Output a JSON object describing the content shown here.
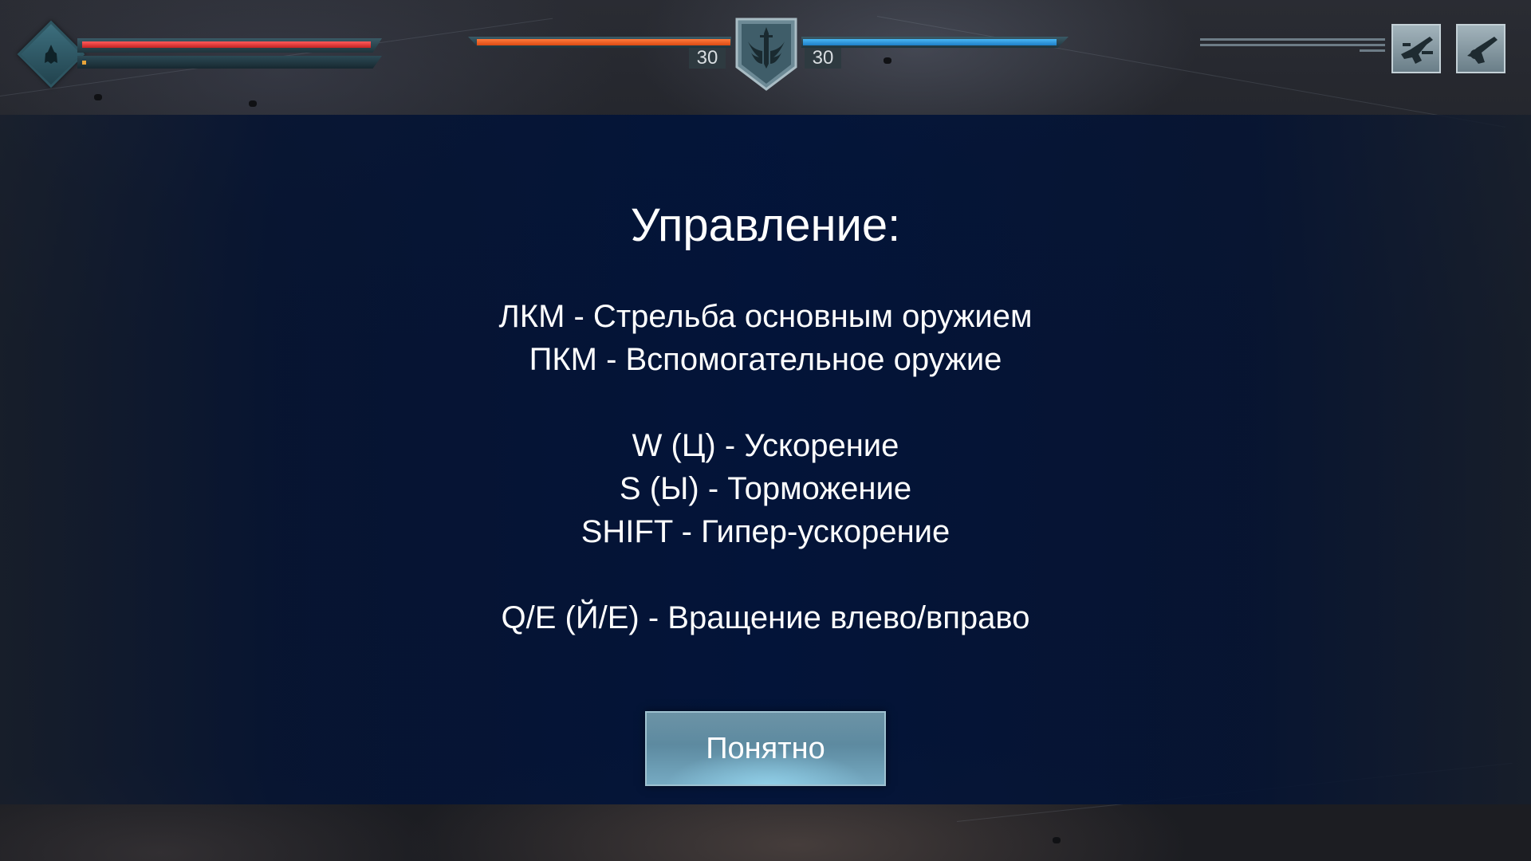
{
  "hud": {
    "player": {
      "hp_fraction": 1.0,
      "energy_fraction": 0.02,
      "hp_color": "#e33838",
      "energy_color": "#e8a43a",
      "emblem_icon": "ship-emblem-icon"
    },
    "team_left": {
      "score": "30",
      "bar_fraction": 1.0,
      "color": "#ef5a24"
    },
    "team_right": {
      "score": "30",
      "bar_fraction": 1.0,
      "color": "#2e9be0"
    },
    "center_icon": "sword-wings-shield-icon",
    "abilities": [
      {
        "icon": "cannon-weapon-icon"
      },
      {
        "icon": "turret-weapon-icon"
      }
    ]
  },
  "dialog": {
    "title": "Управление:",
    "lines": [
      "ЛКМ - Стрельба основным оружием",
      "ПКМ - Вспомогательное оружие",
      "",
      "W (Ц) - Ускорение",
      "S (Ы) - Торможение",
      "SHIFT - Гипер-ускорение",
      "",
      "Q/E (Й/Е) - Вращение влево/вправо"
    ],
    "confirm_label": "Понятно"
  }
}
